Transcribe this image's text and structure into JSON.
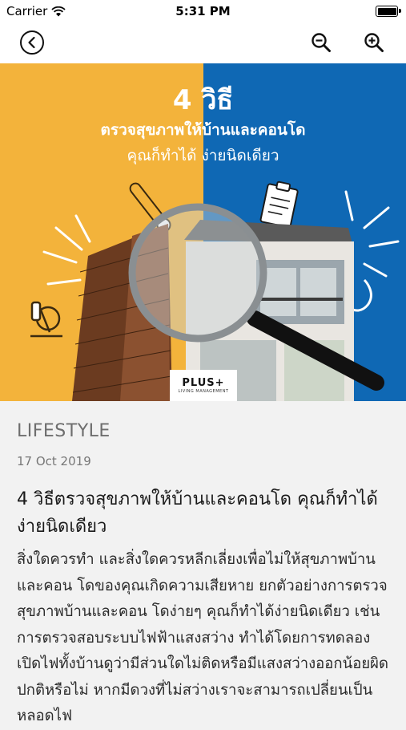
{
  "status_bar": {
    "carrier": "Carrier",
    "time": "5:31 PM"
  },
  "nav": {
    "back_icon": "back-circle-icon",
    "zoom_out_icon": "zoom-out-icon",
    "zoom_in_icon": "zoom-in-icon"
  },
  "hero": {
    "title_line1": "4 วิธี",
    "title_line2": "ตรวจสุขภาพให้บ้านและคอนโด",
    "title_line3": "คุณก็ทำได้ ง่ายนิดเดียว",
    "brand_name": "PLUS+",
    "brand_sub": "LIVING MANAGEMENT",
    "colors": {
      "left": "#f3b33b",
      "right": "#0f68b4"
    }
  },
  "article": {
    "category": "LIFESTYLE",
    "date": "17 Oct 2019",
    "title": "4 วิธีตรวจสุขภาพให้บ้านและคอนโด คุณก็ทำได้ ง่ายนิดเดียว",
    "body": "สิ่งใดควรทำ และสิ่งใดควรหลีกเลี่ยงเพื่อไม่ให้สุขภาพบ้านและคอน โดของคุณเกิดความเสียหาย ยกตัวอย่างการตรวจสุขภาพบ้านและคอน โดง่ายๆ คุณก็ทำได้ง่ายนิดเดียว เช่น การตรวจสอบระบบไฟฟ้าแสงสว่าง ทำได้โดยการทดลองเปิดไฟทั้งบ้านดูว่ามีส่วนใดไม่ติดหรือมีแสงสว่างออกน้อยผิดปกติหรือไม่ หากมีดวงที่ไม่สว่างเราจะสามารถเปลี่ยนเป็นหลอดไฟ"
  }
}
